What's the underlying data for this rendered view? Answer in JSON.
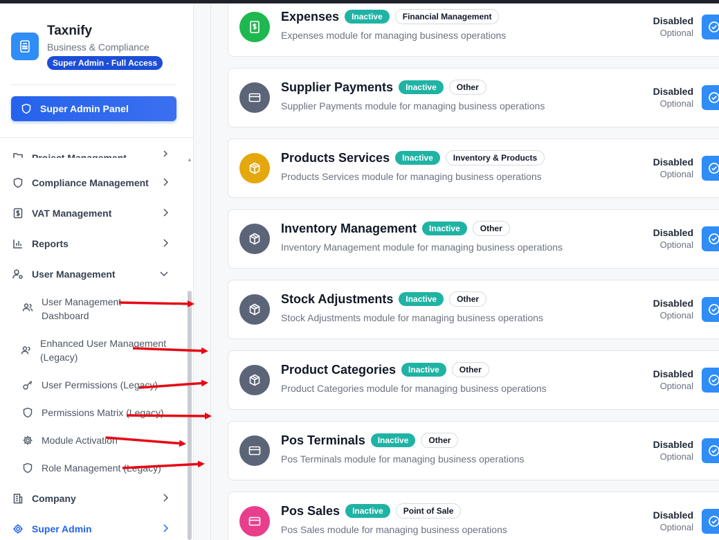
{
  "brand": {
    "name": "Taxnify",
    "subtitle": "Business & Compliance",
    "badge": "Super Admin - Full Access"
  },
  "admin_panel_label": "Super Admin Panel",
  "sidebar": {
    "items": [
      {
        "label": "Project Management",
        "icon": "folder-icon"
      },
      {
        "label": "Compliance Management",
        "icon": "shield-icon"
      },
      {
        "label": "VAT Management",
        "icon": "dollar-icon"
      },
      {
        "label": "Reports",
        "icon": "bar-chart-icon"
      },
      {
        "label": "User Management",
        "icon": "user-cog-icon"
      },
      {
        "label": "Company",
        "icon": "building-icon"
      },
      {
        "label": "Super Admin",
        "icon": "gear-icon"
      }
    ],
    "sub_items": [
      {
        "label": "User Management Dashboard",
        "icon": "users-icon"
      },
      {
        "label": "Enhanced User Management (Legacy)",
        "icon": "users-icon"
      },
      {
        "label": "User Permissions (Legacy)",
        "icon": "key-icon"
      },
      {
        "label": "Permissions Matrix (Legacy)",
        "icon": "shield-icon"
      },
      {
        "label": "Module Activation",
        "icon": "gear-icon"
      },
      {
        "label": "Role Management (Legacy)",
        "icon": "shield-icon"
      }
    ]
  },
  "modules": [
    {
      "title": "Expenses",
      "status_badge": "Inactive",
      "category": "Financial Management",
      "description": "Expenses module for managing business operations",
      "status": "Disabled",
      "requirement": "Optional",
      "icon": "dollar-doc-icon",
      "color": "#1fb84f"
    },
    {
      "title": "Supplier Payments",
      "status_badge": "Inactive",
      "category": "Other",
      "description": "Supplier Payments module for managing business operations",
      "status": "Disabled",
      "requirement": "Optional",
      "icon": "credit-card-icon",
      "color": "#5b6577"
    },
    {
      "title": "Products Services",
      "status_badge": "Inactive",
      "category": "Inventory & Products",
      "description": "Products Services module for managing business operations",
      "status": "Disabled",
      "requirement": "Optional",
      "icon": "package-icon",
      "color": "#e4a80e"
    },
    {
      "title": "Inventory Management",
      "status_badge": "Inactive",
      "category": "Other",
      "description": "Inventory Management module for managing business operations",
      "status": "Disabled",
      "requirement": "Optional",
      "icon": "package-icon",
      "color": "#5b6577"
    },
    {
      "title": "Stock Adjustments",
      "status_badge": "Inactive",
      "category": "Other",
      "description": "Stock Adjustments module for managing business operations",
      "status": "Disabled",
      "requirement": "Optional",
      "icon": "package-icon",
      "color": "#5b6577"
    },
    {
      "title": "Product Categories",
      "status_badge": "Inactive",
      "category": "Other",
      "description": "Product Categories module for managing business operations",
      "status": "Disabled",
      "requirement": "Optional",
      "icon": "package-icon",
      "color": "#5b6577"
    },
    {
      "title": "Pos Terminals",
      "status_badge": "Inactive",
      "category": "Other",
      "description": "Pos Terminals module for managing business operations",
      "status": "Disabled",
      "requirement": "Optional",
      "icon": "credit-card-icon",
      "color": "#5b6577"
    },
    {
      "title": "Pos Sales",
      "status_badge": "Inactive",
      "category": "Point of Sale",
      "description": "Pos Sales module for managing business operations",
      "status": "Disabled",
      "requirement": "Optional",
      "icon": "credit-card-icon",
      "color": "#e83e8c"
    }
  ],
  "colors": {
    "accent": "#2563eb",
    "inactive_badge": "#1fb3a4",
    "annotation_arrow": "#e50914"
  }
}
